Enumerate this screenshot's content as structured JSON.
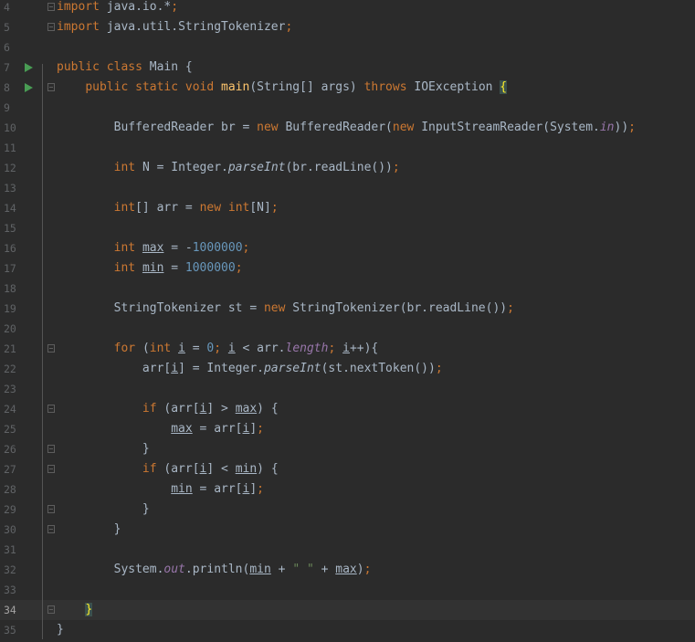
{
  "editor": {
    "current_line": 34,
    "lines": [
      {
        "no": "4",
        "tokens": [
          [
            "k",
            "import "
          ],
          [
            "t",
            "java.io.*"
          ],
          [
            "k",
            ";"
          ]
        ],
        "fold": "start"
      },
      {
        "no": "5",
        "tokens": [
          [
            "k",
            "import "
          ],
          [
            "t",
            "java.util.StringTokenizer"
          ],
          [
            "k",
            ";"
          ]
        ],
        "fold": "end"
      },
      {
        "no": "6",
        "tokens": []
      },
      {
        "no": "7",
        "tokens": [
          [
            "k",
            "public class "
          ],
          [
            "t",
            "Main {"
          ]
        ],
        "run": true
      },
      {
        "no": "8",
        "tokens": [
          [
            "t",
            "    "
          ],
          [
            "k",
            "public static void "
          ],
          [
            "f",
            "main"
          ],
          [
            "t",
            "(String[] args) "
          ],
          [
            "k",
            "throws "
          ],
          [
            "t",
            "IOException "
          ],
          [
            "br",
            "{"
          ]
        ],
        "run": true,
        "fold": "start"
      },
      {
        "no": "9",
        "tokens": []
      },
      {
        "no": "10",
        "tokens": [
          [
            "t",
            "        BufferedReader br = "
          ],
          [
            "k",
            "new "
          ],
          [
            "t",
            "BufferedReader("
          ],
          [
            "k",
            "new "
          ],
          [
            "t",
            "InputStreamReader(System."
          ],
          [
            "i",
            "in"
          ],
          [
            "t",
            "))"
          ],
          [
            "k",
            ";"
          ]
        ]
      },
      {
        "no": "11",
        "tokens": []
      },
      {
        "no": "12",
        "tokens": [
          [
            "t",
            "        "
          ],
          [
            "k",
            "int "
          ],
          [
            "t",
            "N = Integer."
          ],
          [
            "m",
            "parseInt"
          ],
          [
            "t",
            "(br.readLine())"
          ],
          [
            "k",
            ";"
          ]
        ]
      },
      {
        "no": "13",
        "tokens": []
      },
      {
        "no": "14",
        "tokens": [
          [
            "t",
            "        "
          ],
          [
            "k",
            "int"
          ],
          [
            "t",
            "[] arr = "
          ],
          [
            "k",
            "new int"
          ],
          [
            "t",
            "[N]"
          ],
          [
            "k",
            ";"
          ]
        ]
      },
      {
        "no": "15",
        "tokens": []
      },
      {
        "no": "16",
        "tokens": [
          [
            "t",
            "        "
          ],
          [
            "k",
            "int "
          ],
          [
            "u",
            "max"
          ],
          [
            "t",
            " = -"
          ],
          [
            "n",
            "1000000"
          ],
          [
            "k",
            ";"
          ]
        ]
      },
      {
        "no": "17",
        "tokens": [
          [
            "t",
            "        "
          ],
          [
            "k",
            "int "
          ],
          [
            "u",
            "min"
          ],
          [
            "t",
            " = "
          ],
          [
            "n",
            "1000000"
          ],
          [
            "k",
            ";"
          ]
        ]
      },
      {
        "no": "18",
        "tokens": []
      },
      {
        "no": "19",
        "tokens": [
          [
            "t",
            "        StringTokenizer st = "
          ],
          [
            "k",
            "new "
          ],
          [
            "t",
            "StringTokenizer(br.readLine())"
          ],
          [
            "k",
            ";"
          ]
        ]
      },
      {
        "no": "20",
        "tokens": []
      },
      {
        "no": "21",
        "tokens": [
          [
            "t",
            "        "
          ],
          [
            "k",
            "for "
          ],
          [
            "t",
            "("
          ],
          [
            "k",
            "int "
          ],
          [
            "u",
            "i"
          ],
          [
            "t",
            " = "
          ],
          [
            "n",
            "0"
          ],
          [
            "k",
            "; "
          ],
          [
            "u",
            "i"
          ],
          [
            "t",
            " < arr."
          ],
          [
            "i",
            "length"
          ],
          [
            "k",
            "; "
          ],
          [
            "u",
            "i"
          ],
          [
            "t",
            "++){"
          ]
        ],
        "fold": "start"
      },
      {
        "no": "22",
        "tokens": [
          [
            "t",
            "            arr["
          ],
          [
            "u",
            "i"
          ],
          [
            "t",
            "] = Integer."
          ],
          [
            "m",
            "parseInt"
          ],
          [
            "t",
            "(st.nextToken())"
          ],
          [
            "k",
            ";"
          ]
        ]
      },
      {
        "no": "23",
        "tokens": []
      },
      {
        "no": "24",
        "tokens": [
          [
            "t",
            "            "
          ],
          [
            "k",
            "if "
          ],
          [
            "t",
            "(arr["
          ],
          [
            "u",
            "i"
          ],
          [
            "t",
            "] > "
          ],
          [
            "u",
            "max"
          ],
          [
            "t",
            ") {"
          ]
        ],
        "fold": "start"
      },
      {
        "no": "25",
        "tokens": [
          [
            "t",
            "                "
          ],
          [
            "u",
            "max"
          ],
          [
            "t",
            " = arr["
          ],
          [
            "u",
            "i"
          ],
          [
            "t",
            "]"
          ],
          [
            "k",
            ";"
          ]
        ]
      },
      {
        "no": "26",
        "tokens": [
          [
            "t",
            "            }"
          ]
        ],
        "fold": "end"
      },
      {
        "no": "27",
        "tokens": [
          [
            "t",
            "            "
          ],
          [
            "k",
            "if "
          ],
          [
            "t",
            "(arr["
          ],
          [
            "u",
            "i"
          ],
          [
            "t",
            "] < "
          ],
          [
            "u",
            "min"
          ],
          [
            "t",
            ") {"
          ]
        ],
        "fold": "start"
      },
      {
        "no": "28",
        "tokens": [
          [
            "t",
            "                "
          ],
          [
            "u",
            "min"
          ],
          [
            "t",
            " = arr["
          ],
          [
            "u",
            "i"
          ],
          [
            "t",
            "]"
          ],
          [
            "k",
            ";"
          ]
        ]
      },
      {
        "no": "29",
        "tokens": [
          [
            "t",
            "            }"
          ]
        ],
        "fold": "end"
      },
      {
        "no": "30",
        "tokens": [
          [
            "t",
            "        }"
          ]
        ],
        "fold": "end"
      },
      {
        "no": "31",
        "tokens": []
      },
      {
        "no": "32",
        "tokens": [
          [
            "t",
            "        System."
          ],
          [
            "i",
            "out"
          ],
          [
            "t",
            ".println("
          ],
          [
            "u",
            "min"
          ],
          [
            "t",
            " + "
          ],
          [
            "s",
            "\" \""
          ],
          [
            "t",
            " + "
          ],
          [
            "u",
            "max"
          ],
          [
            "t",
            ")"
          ],
          [
            "k",
            ";"
          ]
        ]
      },
      {
        "no": "33",
        "tokens": []
      },
      {
        "no": "34",
        "tokens": [
          [
            "t",
            "    "
          ],
          [
            "br",
            "}"
          ]
        ],
        "fold": "end"
      },
      {
        "no": "35",
        "tokens": [
          [
            "t",
            "}"
          ]
        ]
      }
    ]
  }
}
